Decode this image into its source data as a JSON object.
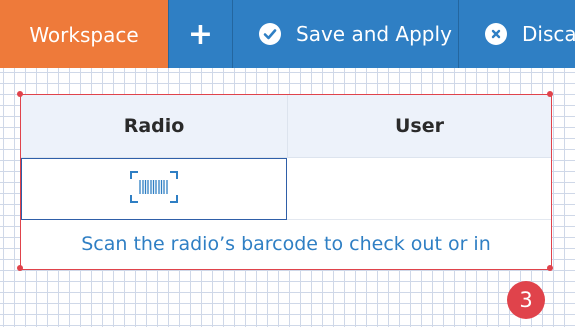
{
  "toolbar": {
    "workspace_label": "Workspace",
    "add_label": "+",
    "save_label": "Save and Apply",
    "discard_label": "Discard"
  },
  "table": {
    "headers": [
      "Radio",
      "User"
    ],
    "rows": [
      {
        "radio": "barcode-scan-icon",
        "user": ""
      }
    ],
    "hint": "Scan the radio’s barcode to check out or in"
  },
  "badge": "3",
  "icons": {
    "save": "check-circle-icon",
    "discard": "close-circle-icon",
    "radio_cell": "barcode-scan-icon"
  },
  "colors": {
    "toolbar": "#2f7fc4",
    "workspace_tab": "#ee7a3a",
    "selection": "#e0434b",
    "hint_text": "#2f7fc4",
    "header_bg": "#edf2fa"
  }
}
